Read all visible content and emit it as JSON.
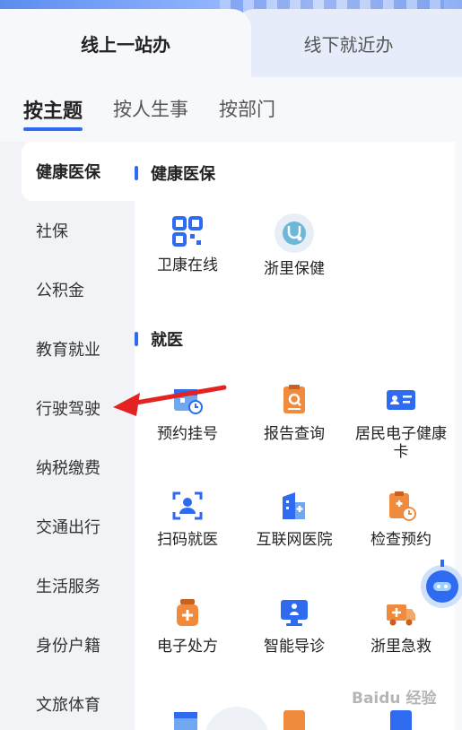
{
  "mode_tabs": [
    {
      "label": "线上一站办",
      "active": true
    },
    {
      "label": "线下就近办",
      "active": false
    }
  ],
  "category_tabs": [
    {
      "label": "按主题",
      "active": true
    },
    {
      "label": "按人生事",
      "active": false
    },
    {
      "label": "按部门",
      "active": false
    }
  ],
  "side_nav": [
    {
      "label": "健康医保",
      "active": true
    },
    {
      "label": "社保"
    },
    {
      "label": "公积金"
    },
    {
      "label": "教育就业"
    },
    {
      "label": "行驶驾驶"
    },
    {
      "label": "纳税缴费"
    },
    {
      "label": "交通出行"
    },
    {
      "label": "生活服务"
    },
    {
      "label": "身份户籍"
    },
    {
      "label": "文旅体育"
    }
  ],
  "sections": [
    {
      "title": "健康医保",
      "services": [
        {
          "label": "卫康在线",
          "icon": "grid-qr-icon"
        },
        {
          "label": "浙里保健",
          "icon": "stethoscope-icon"
        }
      ]
    },
    {
      "title": "就医",
      "services": [
        {
          "label": "预约挂号",
          "icon": "calendar-clock-icon"
        },
        {
          "label": "报告查询",
          "icon": "report-search-icon"
        },
        {
          "label": "居民电子健康卡",
          "icon": "health-card-icon"
        },
        {
          "label": "扫码就医",
          "icon": "scan-user-icon"
        },
        {
          "label": "互联网医院",
          "icon": "hospital-building-icon"
        },
        {
          "label": "检查预约",
          "icon": "clipboard-clock-icon"
        },
        {
          "label": "电子处方",
          "icon": "medicine-bottle-icon"
        },
        {
          "label": "智能导诊",
          "icon": "monitor-guide-icon"
        },
        {
          "label": "浙里急救",
          "icon": "ambulance-icon"
        }
      ]
    }
  ],
  "watermark": "Baidu 经验",
  "colors": {
    "accent": "#2f6bf0",
    "orange": "#f08a3c",
    "arrow": "#e32222"
  }
}
